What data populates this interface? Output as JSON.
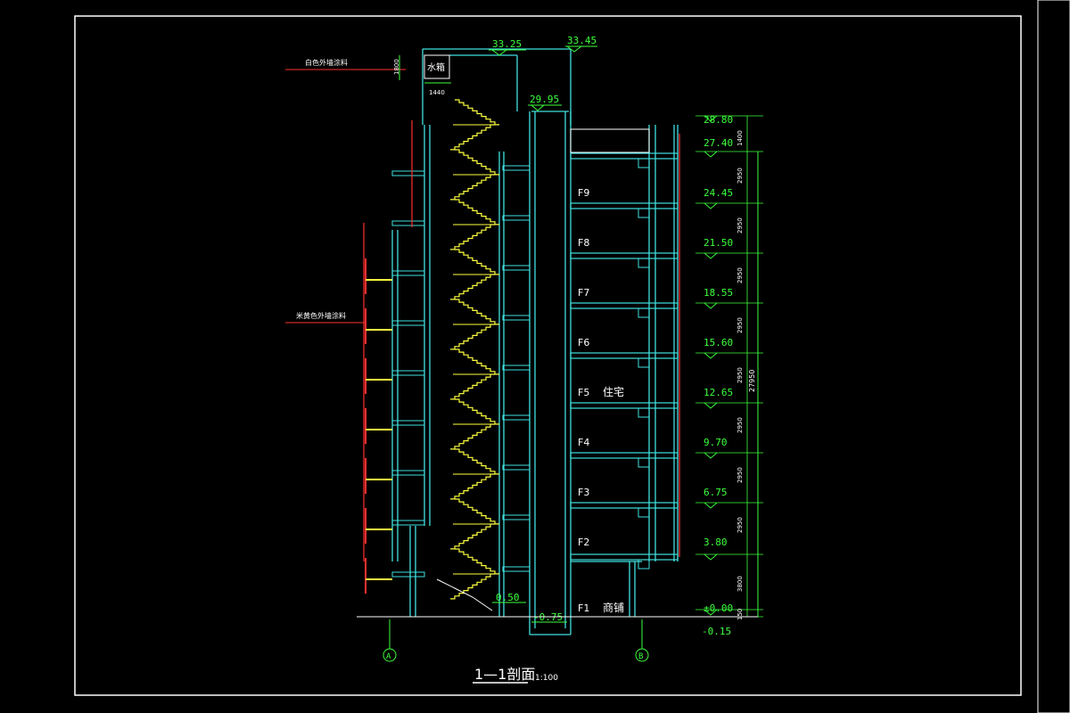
{
  "drawing": {
    "title": "1—1剖面",
    "scale": "1:100"
  },
  "top": {
    "elev_roof": "33.25",
    "elev_top": "33.45",
    "elev_stair_roof": "29.95",
    "tank_label": "水箱",
    "dim_tank_h": "1800",
    "dim_tank_w": "1440"
  },
  "notes": {
    "upper": "白色外墙涂料",
    "lower": "米黄色外墙涂料"
  },
  "floors": [
    {
      "label": "F9",
      "use": ""
    },
    {
      "label": "F8",
      "use": ""
    },
    {
      "label": "F7",
      "use": ""
    },
    {
      "label": "F6",
      "use": ""
    },
    {
      "label": "F5",
      "use": "住宅"
    },
    {
      "label": "F4",
      "use": ""
    },
    {
      "label": "F3",
      "use": ""
    },
    {
      "label": "F2",
      "use": ""
    },
    {
      "label": "F1",
      "use": "商铺"
    }
  ],
  "elevations": [
    "28.80",
    "27.40",
    "24.45",
    "21.50",
    "18.55",
    "15.60",
    "12.65",
    "9.70",
    "6.75",
    "3.80",
    "±0.00",
    "-0.15"
  ],
  "pit_elevations": {
    "stair_bottom": "0.50",
    "lift_pit": "-0.75"
  },
  "dimensions": {
    "segments": [
      "1400",
      "2950",
      "2950",
      "2950",
      "2950",
      "2950",
      "2950",
      "2950",
      "2950",
      "3800",
      "150"
    ],
    "total": "27950"
  },
  "axes": {
    "left": "A",
    "right": "B"
  },
  "colors": {
    "background": "#000000",
    "frame": "#ffffff",
    "wall": "#40e0e0",
    "stair": "#ffff40",
    "dimension": "#3cff3c",
    "rail": "#ff3030"
  }
}
